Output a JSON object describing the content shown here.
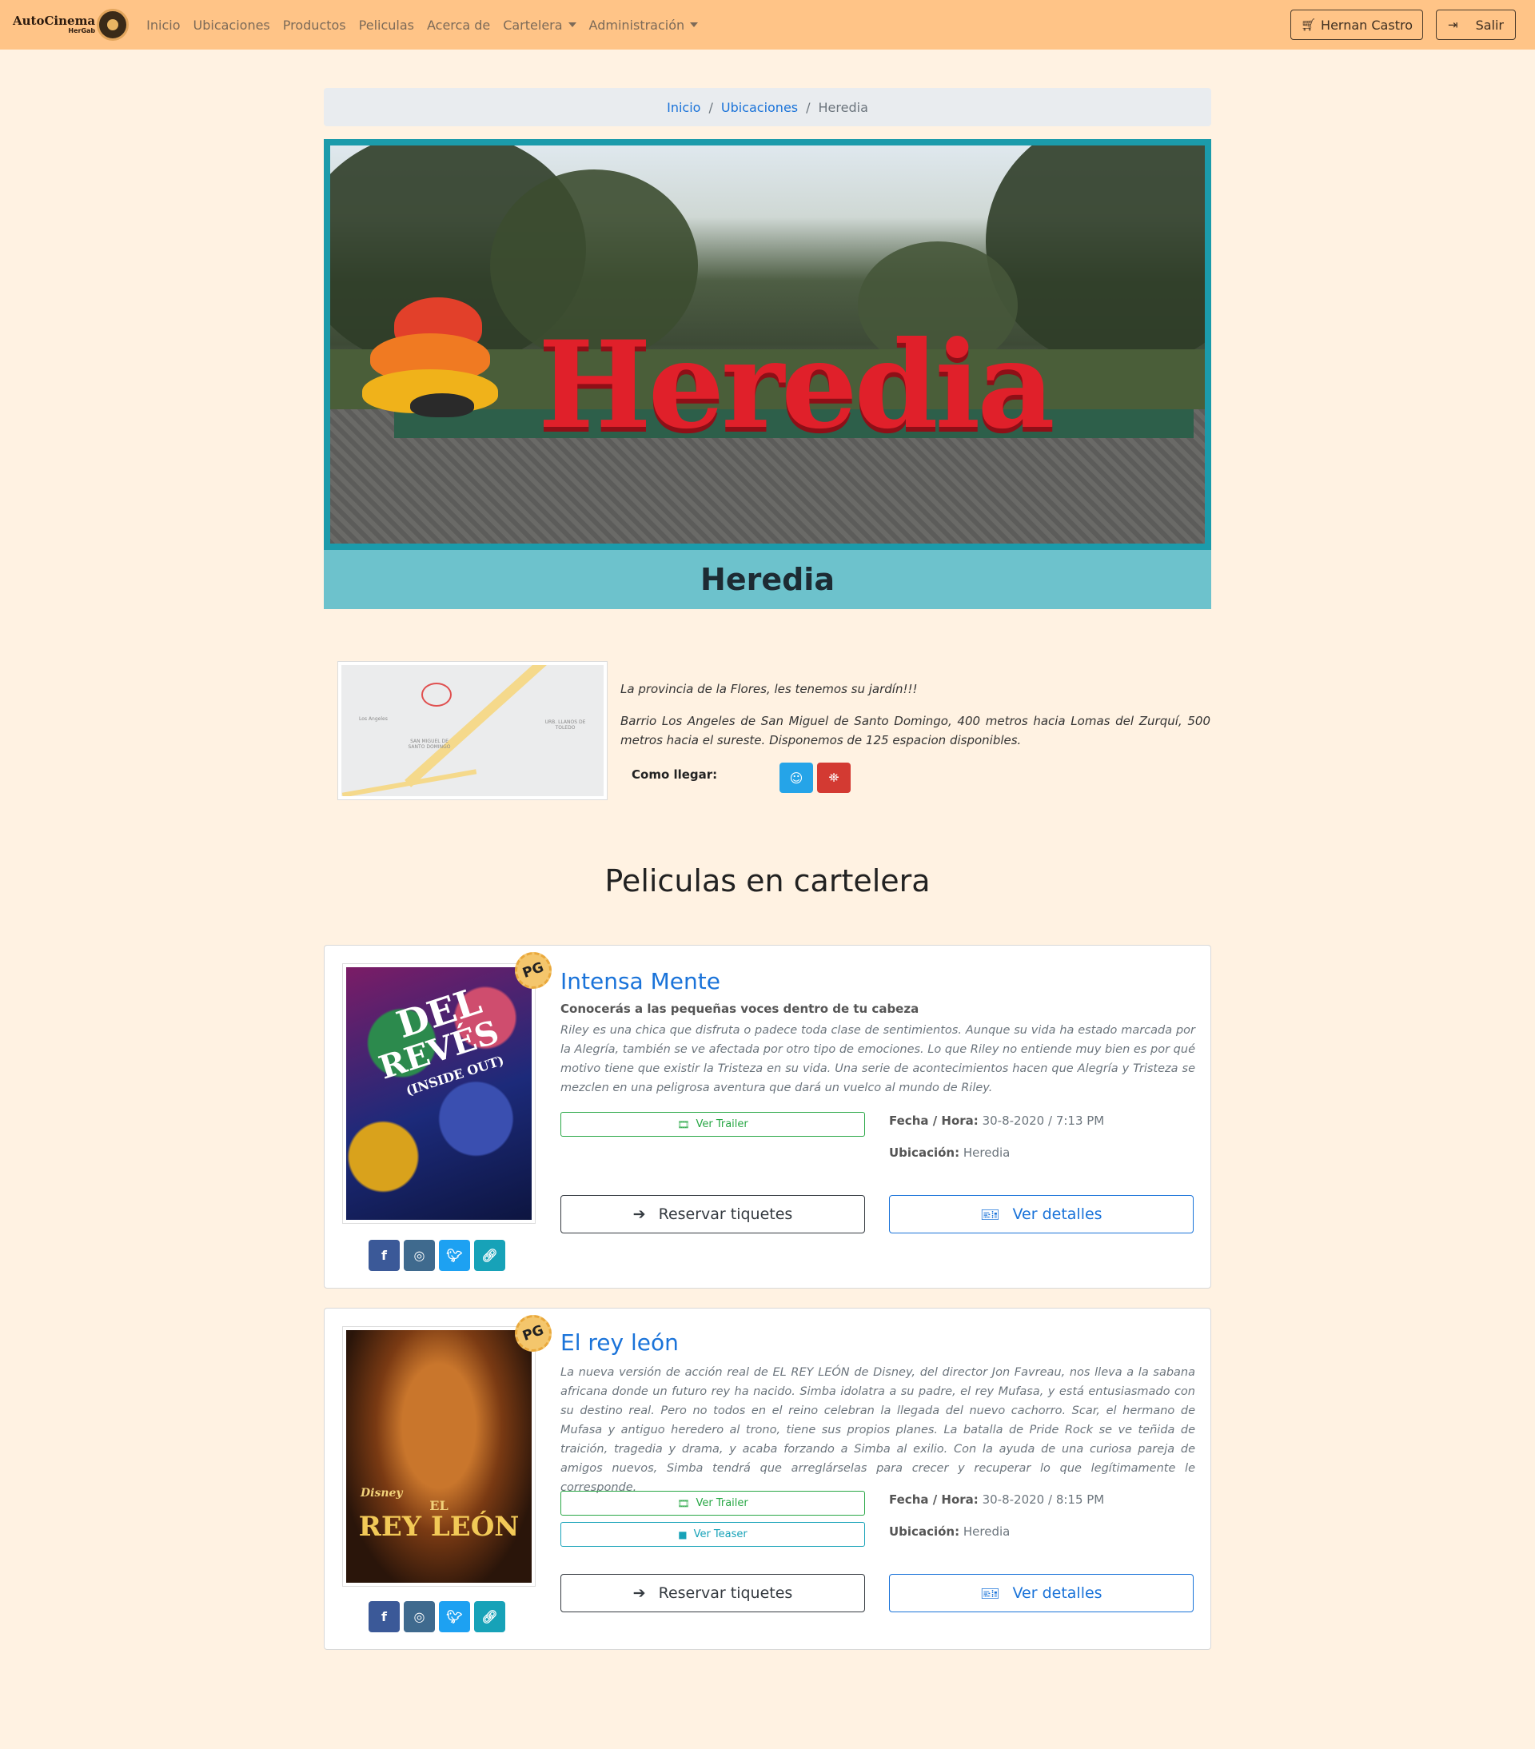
{
  "navbar": {
    "brand_line1": "AutoCinema",
    "brand_line2": "HerGab",
    "links": [
      "Inicio",
      "Ubicaciones",
      "Productos",
      "Peliculas",
      "Acerca de",
      "Cartelera",
      "Administración"
    ],
    "user_label": "Hernan Castro",
    "logout_label": "Salir"
  },
  "breadcrumb": {
    "home": "Inicio",
    "locations": "Ubicaciones",
    "current": "Heredia"
  },
  "hero": {
    "sign_text": "Heredia",
    "caption": "Heredia"
  },
  "location": {
    "map_labels": {
      "los_angeles": "Los Angeles",
      "san_miguel": "SAN MIGUEL DE SANTO DOMINGO",
      "llanos": "URB. LLANOS DE TOLEDO"
    },
    "slogan": "La provincia de la Flores, les tenemos su jardín!!!",
    "address": "Barrio Los Angeles de San Miguel de Santo Domingo, 400 metros hacia Lomas del Zurquí, 500 metros hacia el sureste. Disponemos de 125 espacion disponibles.",
    "como_llegar": "Como llegar:"
  },
  "section_title": "Peliculas en cartelera",
  "movies": [
    {
      "rating": "PG",
      "title": "Intensa Mente",
      "tagline": "Conocerás a las pequeñas voces dentro de tu cabeza",
      "description": "Riley es una chica que disfruta o padece toda clase de sentimientos. Aunque su vida ha estado marcada por la Alegría, también se ve afectada por otro tipo de emociones. Lo que Riley no entiende muy bien es por qué motivo tiene que existir la Tristeza en su vida. Una serie de acontecimientos hacen que Alegría y Tristeza se mezclen en una peligrosa aventura que dará un vuelco al mundo de Riley.",
      "trailer_label": "Ver Trailer",
      "fecha_label": "Fecha / Hora:",
      "fecha_value": "30-8-2020 / 7:13 PM",
      "ubicacion_label": "Ubicación:",
      "ubicacion_value": "Heredia",
      "reserve_label": "Reservar tiquetes",
      "details_label": "Ver detalles",
      "poster_text_1": "DEL",
      "poster_text_2": "REVÉS",
      "poster_text_3": "(INSIDE OUT)"
    },
    {
      "rating": "PG",
      "title": "El rey león",
      "description": "La nueva versión de acción real de EL REY LEÓN de Disney, del director Jon Favreau, nos lleva a la sabana africana donde un futuro rey ha nacido. Simba idolatra a su padre, el rey Mufasa, y está entusiasmado con su destino real. Pero no todos en el reino celebran la llegada del nuevo cachorro. Scar, el hermano de Mufasa y antiguo heredero al trono, tiene sus propios planes. La batalla de Pride Rock se ve teñida de traición, tragedia y drama, y acaba forzando a Simba al exilio. Con la ayuda de una curiosa pareja de amigos nuevos, Simba tendrá que arreglárselas para crecer y recuperar lo que legítimamente le corresponde.",
      "trailer_label": "Ver Trailer",
      "teaser_label": "Ver Teaser",
      "fecha_label": "Fecha / Hora:",
      "fecha_value": "30-8-2020 / 8:15 PM",
      "ubicacion_label": "Ubicación:",
      "ubicacion_value": "Heredia",
      "reserve_label": "Reservar tiquetes",
      "details_label": "Ver detalles",
      "poster_text_1": "Disney",
      "poster_text_2": "EL",
      "poster_text_3": "REY LEÓN"
    }
  ],
  "colors": {
    "navbar": "#ffc487",
    "page_bg": "#fff2e2",
    "hero_frame": "#1b9bab",
    "hero_caption": "#6dc2cc",
    "link": "#1a73d9"
  }
}
